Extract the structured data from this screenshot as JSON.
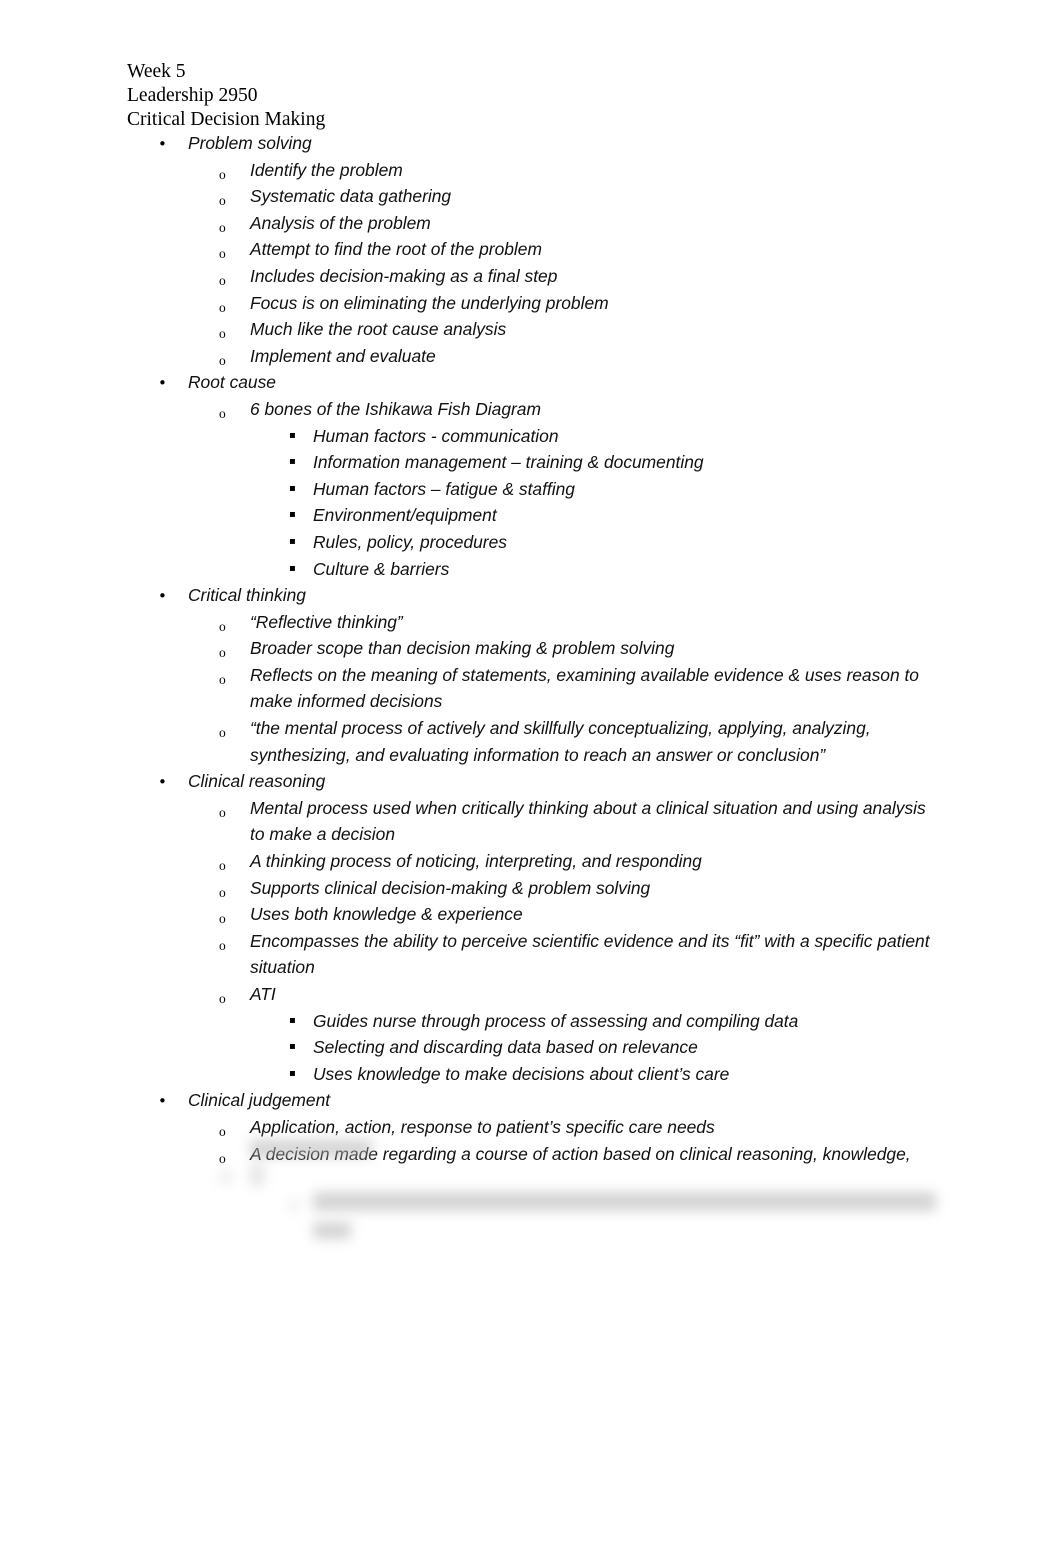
{
  "document": {
    "header_lines": [
      "Week 5",
      "Leadership 2950",
      "Critical Decision Making"
    ],
    "markers": {
      "level1": "•",
      "level2": "o",
      "level3": "▪"
    },
    "outline": [
      {
        "level": 1,
        "text": "Problem solving"
      },
      {
        "level": 2,
        "text": "Identify the problem"
      },
      {
        "level": 2,
        "text": "Systematic data gathering"
      },
      {
        "level": 2,
        "text": "Analysis of the problem"
      },
      {
        "level": 2,
        "text": "Attempt to find the root of the problem"
      },
      {
        "level": 2,
        "text": "Includes decision-making as a final step"
      },
      {
        "level": 2,
        "text": "Focus is on eliminating the underlying problem"
      },
      {
        "level": 2,
        "text": "Much like the root cause analysis"
      },
      {
        "level": 2,
        "text": "Implement and evaluate"
      },
      {
        "level": 1,
        "text": "Root cause"
      },
      {
        "level": 2,
        "text": "6 bones of the Ishikawa Fish Diagram"
      },
      {
        "level": 3,
        "text": "Human factors - communication"
      },
      {
        "level": 3,
        "text": "Information management – training & documenting"
      },
      {
        "level": 3,
        "text": "Human factors – fatigue & staffing"
      },
      {
        "level": 3,
        "text": "Environment/equipment"
      },
      {
        "level": 3,
        "text": "Rules, policy, procedures"
      },
      {
        "level": 3,
        "text": "Culture & barriers"
      },
      {
        "level": 1,
        "text": "Critical thinking"
      },
      {
        "level": 2,
        "text": "“Reflective thinking”"
      },
      {
        "level": 2,
        "text": "Broader scope than decision making & problem solving"
      },
      {
        "level": 2,
        "text": "Reflects on the meaning of statements, examining available evidence & uses reason to make informed decisions"
      },
      {
        "level": 2,
        "text": "“the mental process of actively and skillfully conceptualizing, applying, analyzing, synthesizing, and evaluating information to reach an answer or conclusion”"
      },
      {
        "level": 1,
        "text": "Clinical reasoning"
      },
      {
        "level": 2,
        "text": "Mental process used when critically thinking about a clinical situation and using analysis to make a decision"
      },
      {
        "level": 2,
        "text": "A thinking process of noticing, interpreting, and responding"
      },
      {
        "level": 2,
        "text": "Supports clinical decision-making & problem solving"
      },
      {
        "level": 2,
        "text": "Uses both knowledge & experience"
      },
      {
        "level": 2,
        "text": "Encompasses the ability to perceive scientific evidence and its “fit” with a specific patient situation"
      },
      {
        "level": 2,
        "text": "ATI"
      },
      {
        "level": 3,
        "text": "Guides nurse through process of assessing and compiling data"
      },
      {
        "level": 3,
        "text": "Selecting and discarding data based on relevance"
      },
      {
        "level": 3,
        "text": "Uses knowledge to make decisions about client’s care"
      },
      {
        "level": 1,
        "text": "Clinical judgement"
      },
      {
        "level": 2,
        "text": "Application, action, response to patient’s specific care needs"
      },
      {
        "level": 2,
        "text": "A decision made regarding a course of action based on clinical reasoning, knowledge,"
      }
    ],
    "obscured_region": {
      "note": "blurred / illegible text at bottom of page",
      "visible_text": ""
    }
  }
}
